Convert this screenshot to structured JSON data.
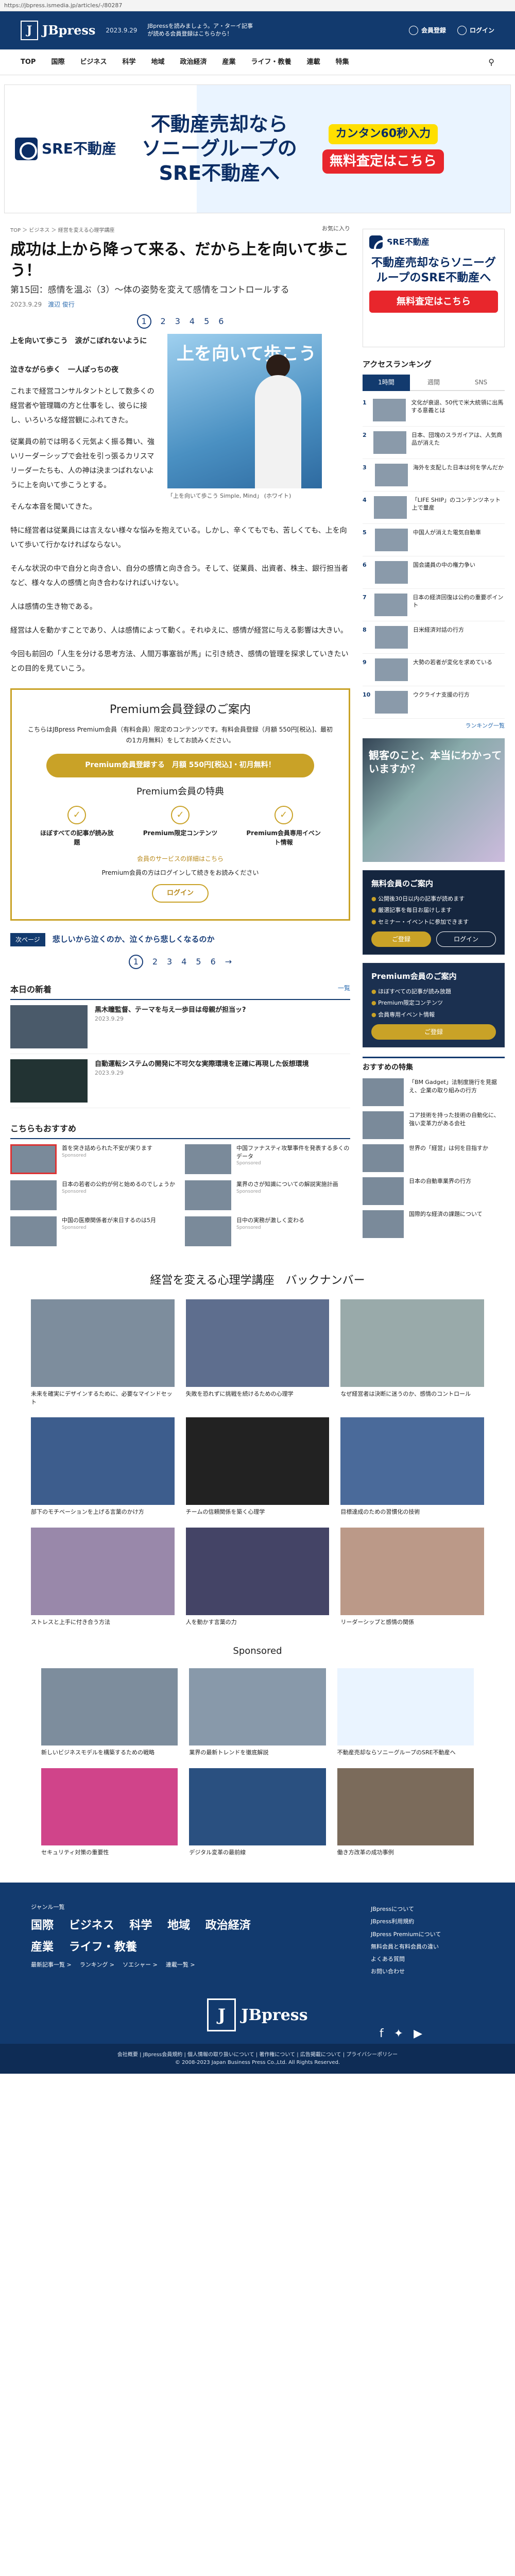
{
  "url": "https://jbpress.ismedia.jp/articles/-/80287",
  "header": {
    "brand": "JBpress",
    "date": "2023.9.29",
    "message": "JBpressを読みましょう。ア・ターイ記事が読める会員登録はこちらから！",
    "member_label": "会員登録",
    "login_label": "ログイン"
  },
  "nav": [
    "TOP",
    "国際",
    "ビジネス",
    "科学",
    "地域",
    "政治経済",
    "産業",
    "ライフ・教養",
    "連載",
    "特集"
  ],
  "ad": {
    "brand": "SRE不動産",
    "copy_line1": "不動産売却なら",
    "copy_line2": "ソニーグループの",
    "copy_line3": "SRE不動産へ",
    "badge1": "カンタン60秒入力",
    "badge2": "無料査定はこちら"
  },
  "breadcrumb": "TOP ＞ ビジネス ＞ 経営を変える心理学講座",
  "fav_label": "お気に入り",
  "article": {
    "title": "成功は上から降って来る、だから上を向いて歩こう！",
    "subtitle": "第15回：感情を温ぶ（3）～体の姿勢を変えて感情をコントロールする",
    "date": "2023.9.29",
    "author": "渡辺 俊行",
    "pages": [
      "1",
      "2",
      "3",
      "4",
      "5",
      "6"
    ],
    "lead": "上を向いて歩こう　涙がこぼれないように\n\n泣きながら歩く　一人ぽっちの夜",
    "p1": "これまで経営コンサルタントとして数多くの経営者や管理職の方と仕事をし、彼らに接し、いろいろな経営観にふれてきた。",
    "p2": "従業員の前では明るく元気よく振る舞い、強いリーダーシップで会社を引っ張るカリスマリーダーたちも、人の神は決まつばれないように上を向いて歩こうとする。",
    "p3": "そんな本音を聞いてきた。",
    "caption": "「上を向いて歩こう Simple, Mind」 (ホワイト)",
    "p4": "特に経営者は従業員には言えない様々な悩みを抱えている。しかし、辛くてもでも、苦しくても、上を向いて歩いて行かなければならない。",
    "p5": "そんな状況の中で自分と向き合い、自分の感情と向き合う。そして、従業員、出資者、株主、銀行担当者など、様々な人の感情と向き合わなければいけない。",
    "p6": "人は感情の生き物である。",
    "p7": "経営は人を動かすことであり、人は感情によって動く。それゆえに、感情が経営に与える影響は大きい。",
    "p8": "今回も前回の「人生を分ける思考方法、人間万事塞翁が馬」に引き続き、感情の管理を探求していきたいとの目的を見ていこう。",
    "link_text": "人生を分ける思考方法、人間万事塞翁が馬"
  },
  "premium": {
    "title": "Premium会員登録のご案内",
    "desc": "こちらはJBpress Premium会員（有料会員）限定のコンテンツです。有料会員登録（月額 550円[税込]、最初の1カ月無料）をしてお読みください。",
    "button": "Premium会員登録する　月額 550円[税込]・初月無料！",
    "benefits_title": "Premium会員の特典",
    "benefits": [
      "ほぼすべての記事が読み放題",
      "Premium限定コンテンツ",
      "Premium会員専用イベント情報"
    ],
    "detail_link": "会員のサービスの詳細はこちら",
    "login_note": "Premium会員の方はログインして続きをお読みください",
    "login_button": "ログイン"
  },
  "next": {
    "tag": "次ページ",
    "text": "悲しいから泣くのか、泣くから悲しくなるのか"
  },
  "new_articles": {
    "heading": "本日の新着",
    "more": "一覧",
    "items": [
      {
        "title": "黒木瞳監督、テーマを与え一歩目は母親が担当ッ?",
        "date": "2023.9.29"
      },
      {
        "title": "自動運転システムの開発に不可欠な実際環境を正確に再現した仮想環境",
        "date": "2023.9.29"
      }
    ]
  },
  "recommend": {
    "heading": "こちらもおすすめ",
    "items": [
      {
        "title": "首を突き詰められた不安が実ります",
        "sp": "Sponsored"
      },
      {
        "title": "中国ファナスティ攻撃事件を発表する多くのデータ",
        "sp": "Sponsored"
      },
      {
        "title": "日本の若者の公約が何と始めるのでしょうか",
        "sp": "Sponsored"
      },
      {
        "title": "業界のさが知識についての解説実施計画",
        "sp": "Sponsored"
      },
      {
        "title": "中国の医療関係者が来日するのは5月",
        "sp": "Sponsored"
      },
      {
        "title": "日中の実務が激しく変わる",
        "sp": "Sponsored"
      }
    ]
  },
  "sidebar": {
    "ad_brand": "SRE不動産",
    "ad_copy": "不動産売却ならソニーグループのSRE不動産へ",
    "ad_button": "無料査定はこちら",
    "rank_title": "アクセスランキング",
    "rank_tabs": [
      "1時間",
      "週間",
      "SNS"
    ],
    "rank_items": [
      "文化が衰退、50代で米大統領に出馬する意義とは",
      "日本、団塊のスラガイアは、人気商品が消えた",
      "海外を支配した日本は何を学んだか",
      "「LIFE SHIP」のコンテンツネット上で量産",
      "中国人が消えた電気自動車",
      "国会議員の中の権力争い",
      "日本の経済回復は公約の重要ポイント",
      "日米経済対話の行方",
      "大勢の若者が変化を求めている",
      "ウクライナ支援の行方"
    ],
    "rank_more": "ランキング一覧",
    "free_title": "無料会員のご案内",
    "free_items": [
      "公開後30日以内の記事が読めます",
      "厳選記事を毎日お届けします",
      "セミナー・イベントに参加できます"
    ],
    "prem_title": "Premium会員のご案内",
    "prem_items": [
      "ほぼすべての記事が読み放題",
      "Premium限定コンテンツ",
      "会員専用イベント情報"
    ],
    "btn_detail": "ご登録",
    "btn_login": "ログイン",
    "photo_q": "観客のこと、本当にわかっていますか？",
    "os_title": "おすすめの特集",
    "os_items": [
      "「BM Gadget」法制度施行を見据え、企業の取り組みの行方",
      "コア技術を持った技術の自動化に、強い変革力がある会社",
      "世界の「経営」は何を目指すか",
      "日本の自動車業界の行方",
      "国際的な経済の課題について"
    ]
  },
  "backnumber": {
    "title": "経営を変える心理学講座　バックナンバー",
    "more": "一覧",
    "items": [
      "未来を確実にデザインするために、必要なマインドセット",
      "失敗を恐れずに挑戦を続けるための心理学",
      "なぜ経営者は決断に迷うのか、感情のコントロール",
      "部下のモチベーションを上げる言葉のかけ方",
      "チームの信頼関係を築く心理学",
      "目標達成のための習慣化の技術",
      "ストレスと上手に付き合う方法",
      "人を動かす言葉の力",
      "リーダーシップと感情の関係"
    ]
  },
  "sponsored": {
    "title": "Sponsored",
    "items": [
      "新しいビジネスモデルを構築するための戦略",
      "業界の最新トレンドを徹底解説",
      "不動産売却ならソニーグループのSRE不動産へ",
      "セキュリティ対策の重要性",
      "デジタル変革の最前線",
      "働き方改革の成功事例"
    ]
  },
  "footer": {
    "genre_label": "ジャンル一覧",
    "cats": [
      "国際",
      "ビジネス",
      "科学",
      "地域",
      "政治経済",
      "産業",
      "ライフ・教養"
    ],
    "sub": [
      "最新記事一覧 >",
      "ランキング >",
      "ソエシャー >",
      "連載一覧 >"
    ],
    "links": [
      "JBpressについて",
      "JBpress利用規約",
      "JBpress Premiumについて",
      "無料会員と有料会員の違い",
      "よくある質問",
      "お問い合わせ"
    ],
    "brand": "JBpress",
    "bottom": "会社概要 | JBpress会員規約 | 個人情報の取り扱いについて | 著作権について | 広告掲載について | プライバシーポリシー",
    "copyright": "© 2008-2023 Japan Business Press Co.,Ltd. All Rights Reserved."
  }
}
